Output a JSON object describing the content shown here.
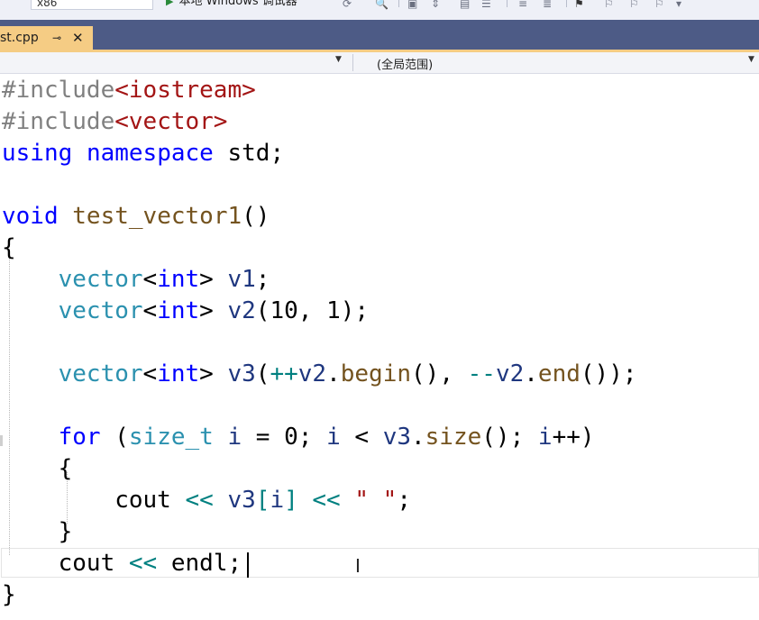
{
  "toolbar": {
    "platform_value": "x86",
    "run_label": "本地 Windows 调试器",
    "run_icon": "play-icon"
  },
  "tab": {
    "file_name": "st.cpp",
    "pin_glyph": "⊸",
    "close_glyph": "✕"
  },
  "navbar": {
    "scope_label": "(全局范围)"
  },
  "editor": {
    "lines": [
      [
        [
          "#include",
          "pp"
        ],
        [
          "<iostream>",
          "inc"
        ]
      ],
      [
        [
          "#include",
          "pp"
        ],
        [
          "<vector>",
          "inc"
        ]
      ],
      [
        [
          "using",
          "kw"
        ],
        [
          " ",
          "pl"
        ],
        [
          "namespace",
          "kw"
        ],
        [
          " std;",
          "pl"
        ]
      ],
      [],
      [
        [
          "void",
          "kw"
        ],
        [
          " ",
          "pl"
        ],
        [
          "test_vector1",
          "fn"
        ],
        [
          "()",
          "pl"
        ]
      ],
      [
        [
          "{",
          "pl"
        ]
      ],
      [
        [
          "    ",
          "pl"
        ],
        [
          "vector",
          "ty"
        ],
        [
          "<",
          "pl"
        ],
        [
          "int",
          "kw"
        ],
        [
          "> ",
          "pl"
        ],
        [
          "v1",
          "vr"
        ],
        [
          ";",
          "pl"
        ]
      ],
      [
        [
          "    ",
          "pl"
        ],
        [
          "vector",
          "ty"
        ],
        [
          "<",
          "pl"
        ],
        [
          "int",
          "kw"
        ],
        [
          "> ",
          "pl"
        ],
        [
          "v2",
          "vr"
        ],
        [
          "(10, 1);",
          "pl"
        ]
      ],
      [],
      [
        [
          "    ",
          "pl"
        ],
        [
          "vector",
          "ty"
        ],
        [
          "<",
          "pl"
        ],
        [
          "int",
          "kw"
        ],
        [
          "> ",
          "pl"
        ],
        [
          "v3",
          "vr"
        ],
        [
          "(",
          "pl"
        ],
        [
          "++",
          "op"
        ],
        [
          "v2",
          "vr"
        ],
        [
          ".",
          "pl"
        ],
        [
          "begin",
          "fn"
        ],
        [
          "(), ",
          "pl"
        ],
        [
          "--",
          "op"
        ],
        [
          "v2",
          "vr"
        ],
        [
          ".",
          "pl"
        ],
        [
          "end",
          "fn"
        ],
        [
          "());",
          "pl"
        ]
      ],
      [],
      [
        [
          "    ",
          "pl"
        ],
        [
          "for",
          "kw"
        ],
        [
          " (",
          "pl"
        ],
        [
          "size_t",
          "ty"
        ],
        [
          " ",
          "pl"
        ],
        [
          "i",
          "vr"
        ],
        [
          " = 0; ",
          "pl"
        ],
        [
          "i",
          "vr"
        ],
        [
          " < ",
          "pl"
        ],
        [
          "v3",
          "vr"
        ],
        [
          ".",
          "pl"
        ],
        [
          "size",
          "fn"
        ],
        [
          "(); ",
          "pl"
        ],
        [
          "i",
          "vr"
        ],
        [
          "++)",
          "pl"
        ]
      ],
      [
        [
          "    {",
          "pl"
        ]
      ],
      [
        [
          "        cout ",
          "pl"
        ],
        [
          "<<",
          "op"
        ],
        [
          " ",
          "pl"
        ],
        [
          "v3",
          "vr"
        ],
        [
          "[",
          "op"
        ],
        [
          "i",
          "vr"
        ],
        [
          "]",
          "op"
        ],
        [
          " ",
          "pl"
        ],
        [
          "<<",
          "op"
        ],
        [
          " ",
          "pl"
        ],
        [
          "\" \"",
          "st"
        ],
        [
          ";",
          "pl"
        ]
      ],
      [
        [
          "    }",
          "pl"
        ]
      ],
      [
        [
          "    cout ",
          "pl"
        ],
        [
          "<<",
          "op"
        ],
        [
          " endl;",
          "pl"
        ]
      ],
      [
        [
          "}",
          "pl"
        ]
      ]
    ]
  }
}
